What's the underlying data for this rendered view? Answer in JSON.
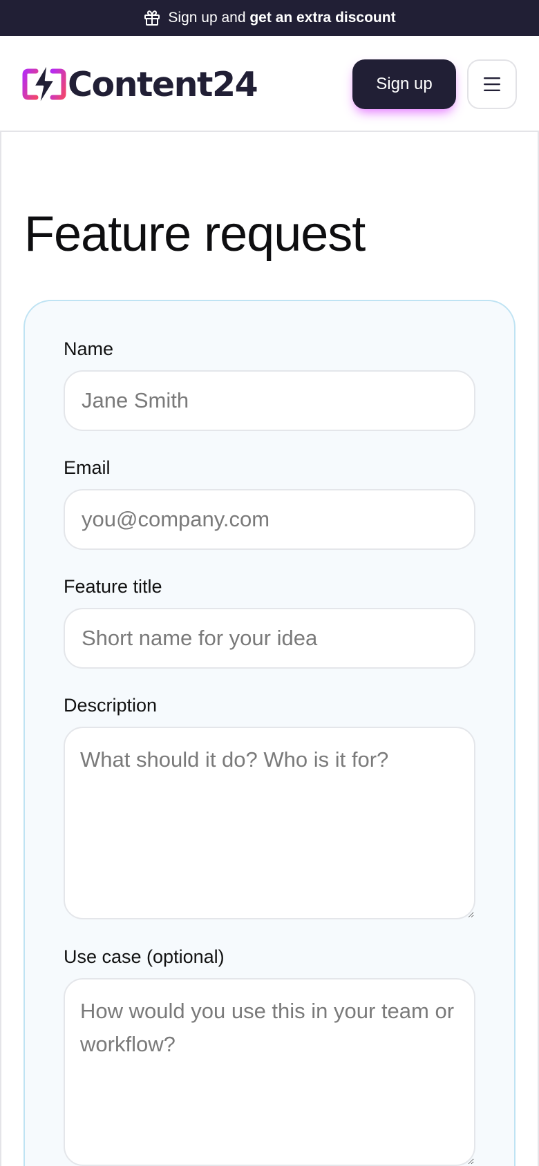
{
  "promo": {
    "icon": "gift-icon",
    "text_prefix": "Sign up and",
    "text_bold": "get an extra discount"
  },
  "header": {
    "logo_text": "Content24",
    "signup_label": "Sign up",
    "menu_icon": "hamburger-menu-icon"
  },
  "page": {
    "title": "Feature request"
  },
  "form": {
    "name": {
      "label": "Name",
      "placeholder": "Jane Smith",
      "value": ""
    },
    "email": {
      "label": "Email",
      "placeholder": "you@company.com",
      "value": ""
    },
    "feature_title": {
      "label": "Feature title",
      "placeholder": "Short name for your idea",
      "value": ""
    },
    "description": {
      "label": "Description",
      "placeholder": "What should it do? Who is it for?",
      "value": ""
    },
    "use_case": {
      "label": "Use case (optional)",
      "placeholder": "How would you use this in your team or workflow?",
      "value": ""
    }
  },
  "colors": {
    "brand_dark": "#211f35",
    "logo_gradient_start": "#b62cf0",
    "logo_gradient_end": "#f0466f",
    "card_border": "#bfe3f3",
    "card_background": "#f6fafd",
    "signup_glow": "#de5aff"
  }
}
